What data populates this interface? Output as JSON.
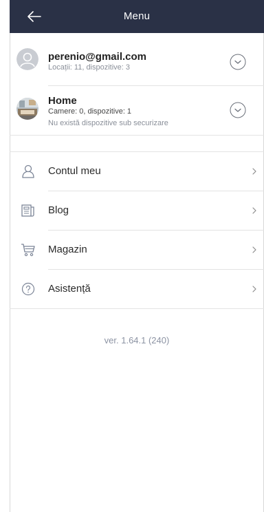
{
  "header": {
    "title": "Menu"
  },
  "accounts": [
    {
      "name": "perenio@gmail.com",
      "details": "Locații: 11, dispozitive: 3"
    },
    {
      "name": "Home",
      "details": "Camere: 0, dispozitive: 1",
      "status": "Nu există dispozitive sub securizare"
    }
  ],
  "menu": {
    "items": [
      {
        "label": "Contul meu",
        "icon": "person-icon"
      },
      {
        "label": "Blog",
        "icon": "blog-icon"
      },
      {
        "label": "Magazin",
        "icon": "cart-icon"
      },
      {
        "label": "Asistență",
        "icon": "help-icon"
      }
    ]
  },
  "footer": {
    "version": "ver. 1.64.1 (240)"
  },
  "colors": {
    "header_bg": "#2a3146",
    "accent_icon": "#7b8496",
    "divider": "#e3e3e3"
  }
}
